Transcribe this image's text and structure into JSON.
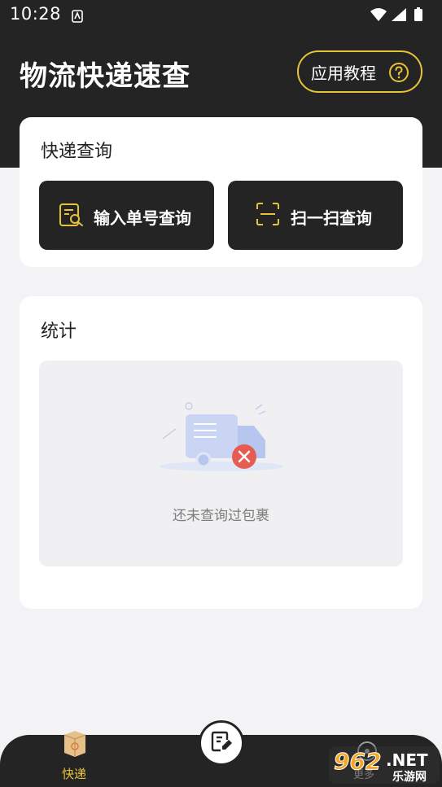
{
  "status_bar": {
    "time": "10:28",
    "notification_icon": "app-notification-icon",
    "icons": [
      "wifi-icon",
      "signal-icon",
      "battery-icon"
    ]
  },
  "header": {
    "title": "物流快递速查",
    "tutorial_label": "应用教程",
    "tutorial_icon": "help-circle-icon",
    "accent_color": "#e8c33a",
    "background_color": "#242424"
  },
  "query_card": {
    "title": "快递查询",
    "input_button_label": "输入单号查询",
    "input_button_icon": "document-search-icon",
    "scan_button_label": "扫一扫查询",
    "scan_button_icon": "scan-icon"
  },
  "stats_card": {
    "title": "统计",
    "empty_text": "还未查询过包裹",
    "empty_icon": "delivery-truck-error-icon"
  },
  "bottom_nav": {
    "items": [
      {
        "label": "快递",
        "icon": "package-box-icon",
        "active": true
      },
      {
        "label": "",
        "icon": "edit-document-icon",
        "active": false
      },
      {
        "label": "更多",
        "icon": "more-icon",
        "active": false
      }
    ]
  },
  "watermark": {
    "brand": "962",
    "suffix": ".NET",
    "subtitle": "乐游网"
  }
}
